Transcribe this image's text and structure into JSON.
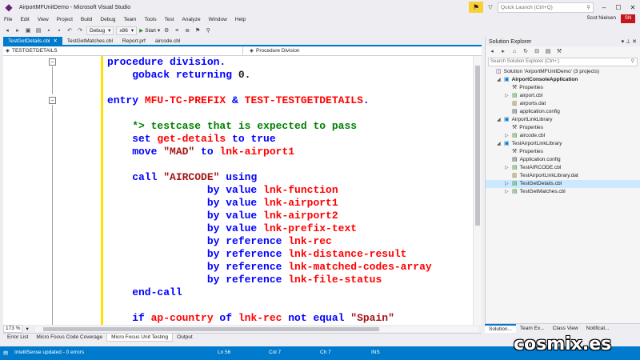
{
  "window": {
    "title": "AirportMFUnitDemo - Microsoft Visual Studio",
    "quick_launch_placeholder": "Quick Launch (Ctrl+Q)"
  },
  "menu": [
    "File",
    "Edit",
    "View",
    "Project",
    "Build",
    "Debug",
    "Team",
    "Tools",
    "Test",
    "Analyze",
    "Window",
    "Help"
  ],
  "user": {
    "name": "Scot Nielsen",
    "initials": "SN"
  },
  "toolbar": {
    "config": "Debug",
    "platform": "x86",
    "start_label": "Start"
  },
  "tabs": [
    "TestGetDetails.cbl",
    "TestGetMatches.cbl",
    "Report.prf",
    "aircode.cbl"
  ],
  "nav": {
    "left": "TESTGETDETAILS",
    "right": "Procedure Division"
  },
  "code": [
    [
      [
        "kw",
        "procedure division."
      ]
    ],
    [
      [
        "kw",
        "    goback returning "
      ],
      [
        "",
        "0."
      ]
    ],
    [],
    [
      [
        "kw",
        "entry "
      ],
      [
        "id",
        "MFU-TC-PREFIX"
      ],
      [
        "kw",
        " & "
      ],
      [
        "id",
        "TEST-TESTGETDETAILS"
      ],
      [
        "kw",
        "."
      ]
    ],
    [],
    [
      [
        "cm",
        "    *> testcase that is expected to pass"
      ]
    ],
    [
      [
        "kw",
        "    set "
      ],
      [
        "id",
        "get-details"
      ],
      [
        "kw",
        " to true"
      ]
    ],
    [
      [
        "kw",
        "    move "
      ],
      [
        "str",
        "\"MAD\""
      ],
      [
        "kw",
        " to "
      ],
      [
        "id",
        "lnk-airport1"
      ]
    ],
    [],
    [
      [
        "kw",
        "    call "
      ],
      [
        "str",
        "\"AIRCODE\""
      ],
      [
        "kw",
        " using"
      ]
    ],
    [
      [
        "kw",
        "                by value "
      ],
      [
        "id",
        "lnk-function"
      ]
    ],
    [
      [
        "kw",
        "                by value "
      ],
      [
        "id",
        "lnk-airport1"
      ]
    ],
    [
      [
        "kw",
        "                by value "
      ],
      [
        "id",
        "lnk-airport2"
      ]
    ],
    [
      [
        "kw",
        "                by value "
      ],
      [
        "id",
        "lnk-prefix-text"
      ]
    ],
    [
      [
        "kw",
        "                by reference "
      ],
      [
        "id",
        "lnk-rec"
      ]
    ],
    [
      [
        "kw",
        "                by reference "
      ],
      [
        "id",
        "lnk-distance-result"
      ]
    ],
    [
      [
        "kw",
        "                by reference "
      ],
      [
        "id",
        "lnk-matched-codes-array"
      ]
    ],
    [
      [
        "kw",
        "                by reference "
      ],
      [
        "id",
        "lnk-file-status"
      ]
    ],
    [
      [
        "kw",
        "    end-call"
      ]
    ],
    [],
    [
      [
        "kw",
        "    if "
      ],
      [
        "id",
        "ap-country"
      ],
      [
        "kw",
        " of "
      ],
      [
        "id",
        "lnk-rec"
      ],
      [
        "kw",
        " not equal "
      ],
      [
        "str",
        "\"Spain\""
      ]
    ]
  ],
  "zoom": "173 %",
  "bottom_tabs": [
    "Error List",
    "Micro Focus Code Coverage",
    "Micro Focus Unit Testing",
    "Output"
  ],
  "status": {
    "message": "IntelliSense updated - 0 errors",
    "ln": "Ln 56",
    "col": "Col 7",
    "ch": "Ch 7",
    "mode": "INS"
  },
  "solution_explorer": {
    "title": "Solution Explorer",
    "search_placeholder": "Search Solution Explorer (Ctrl+;)",
    "nodes": [
      {
        "text": "Solution 'AirportMFUnitDemo' (3 projects)",
        "icon": "sol",
        "indent": 0,
        "twisty": "",
        "bold": false
      },
      {
        "text": "AirportConsoleApplication",
        "icon": "proj",
        "indent": 1,
        "twisty": "◢",
        "bold": true
      },
      {
        "text": "Properties",
        "icon": "prop",
        "indent": 2,
        "twisty": "",
        "bold": false
      },
      {
        "text": "airport.cbl",
        "icon": "cbl",
        "indent": 2,
        "twisty": "▷",
        "bold": false
      },
      {
        "text": "airports.dat",
        "icon": "dat",
        "indent": 2,
        "twisty": "",
        "bold": false
      },
      {
        "text": "application.config",
        "icon": "cfg",
        "indent": 2,
        "twisty": "",
        "bold": false
      },
      {
        "text": "AirportLinkLibrary",
        "icon": "proj",
        "indent": 1,
        "twisty": "◢",
        "bold": false
      },
      {
        "text": "Properties",
        "icon": "prop",
        "indent": 2,
        "twisty": "",
        "bold": false
      },
      {
        "text": "aircode.cbl",
        "icon": "cbl",
        "indent": 2,
        "twisty": "▷",
        "bold": false
      },
      {
        "text": "TestAirportLinkLibrary",
        "icon": "proj",
        "indent": 1,
        "twisty": "◢",
        "bold": false
      },
      {
        "text": "Properties",
        "icon": "prop",
        "indent": 2,
        "twisty": "",
        "bold": false
      },
      {
        "text": "Application.config",
        "icon": "cfg",
        "indent": 2,
        "twisty": "",
        "bold": false
      },
      {
        "text": "TestAIRCODE.cbl",
        "icon": "cbl",
        "indent": 2,
        "twisty": "▷",
        "bold": false
      },
      {
        "text": "TestAirportLinkLibrary.dat",
        "icon": "dat",
        "indent": 2,
        "twisty": "",
        "bold": false
      },
      {
        "text": "TestGetDetails.cbl",
        "icon": "cbl",
        "indent": 2,
        "twisty": "▷",
        "bold": false
      },
      {
        "text": "TestGetMatches.cbl",
        "icon": "cbl",
        "indent": 2,
        "twisty": "▷",
        "bold": false
      }
    ],
    "selected_index": 14,
    "tabs": [
      "Solution...",
      "Team Ex...",
      "Class View",
      "Notificat..."
    ]
  },
  "watermark": "cosmix.es",
  "colors": {
    "accent": "#007acc",
    "keyword": "#0000ff",
    "identifier": "#ff0000",
    "string": "#a31515",
    "comment": "#008000"
  }
}
